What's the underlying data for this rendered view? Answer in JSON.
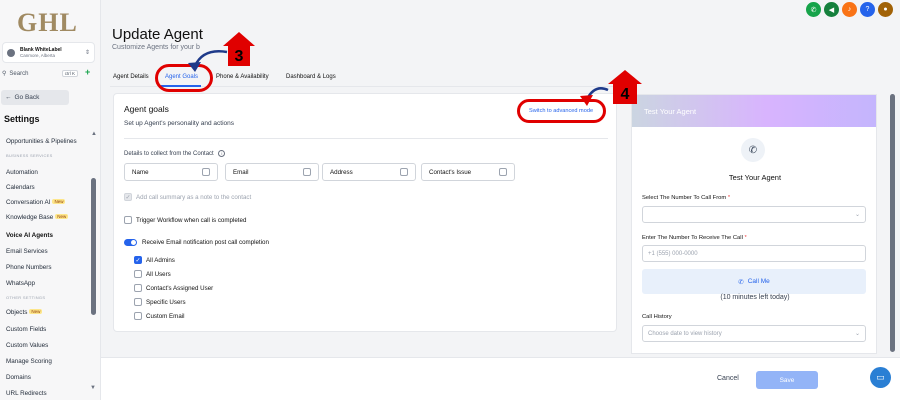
{
  "sidebar": {
    "logo": "GHL",
    "location": {
      "name": "Blank WhiteLabel",
      "place": "Canmore, Alberta"
    },
    "search": {
      "label": "Search",
      "shortcut": "ctrl K"
    },
    "go_back": "Go Back",
    "heading": "Settings",
    "sections": {
      "business": "BUSINESS SERVICES",
      "other": "OTHER SETTINGS"
    },
    "items": [
      {
        "label": "Opportunities & Pipelines"
      },
      {
        "label": "Automation"
      },
      {
        "label": "Calendars"
      },
      {
        "label": "Conversation AI",
        "badge": "New"
      },
      {
        "label": "Knowledge Base",
        "badge": "New"
      },
      {
        "label": "Voice AI Agents"
      },
      {
        "label": "Email Services"
      },
      {
        "label": "Phone Numbers"
      },
      {
        "label": "WhatsApp"
      },
      {
        "label": "Objects",
        "badge": "New"
      },
      {
        "label": "Custom Fields"
      },
      {
        "label": "Custom Values"
      },
      {
        "label": "Manage Scoring"
      },
      {
        "label": "Domains"
      },
      {
        "label": "URL Redirects"
      }
    ]
  },
  "header": {
    "title": "Update Agent",
    "subtitle": "Customize Agents for your b"
  },
  "tabs": [
    {
      "label": "Agent Details"
    },
    {
      "label": "Agent Goals"
    },
    {
      "label": "Phone & Availability"
    },
    {
      "label": "Dashboard & Logs"
    }
  ],
  "goals": {
    "title": "Agent goals",
    "subtitle": "Set up Agent's personality and actions",
    "advanced_link": "Switch to advanced mode",
    "details_label": "Details to collect from the Contact",
    "chips": [
      "Name",
      "Email",
      "Address",
      "Contact's Issue"
    ],
    "add_summary": "Add call summary as a note to the contact",
    "trigger_workflow": "Trigger Workflow when call is completed",
    "receive_email": "Receive Email notification post call completion",
    "recipients": [
      "All Admins",
      "All Users",
      "Contact's Assigned User",
      "Specific Users",
      "Custom Email"
    ]
  },
  "test_panel": {
    "header": "Test Your Agent",
    "title": "Test Your Agent",
    "from_label": "Select The Number To Call From",
    "to_label": "Enter The Number To Receive The Call",
    "to_placeholder": "+1 (555) 000-0000",
    "call_button": "Call Me",
    "minutes_left": "(10 minutes left today)",
    "history_label": "Call History",
    "history_placeholder": "Choose date to view history"
  },
  "footer": {
    "cancel": "Cancel",
    "save": "Save"
  },
  "annotations": {
    "step3": "3",
    "step4": "4"
  },
  "colors": {
    "accent": "#2563eb",
    "annotation_red": "#e00000"
  }
}
